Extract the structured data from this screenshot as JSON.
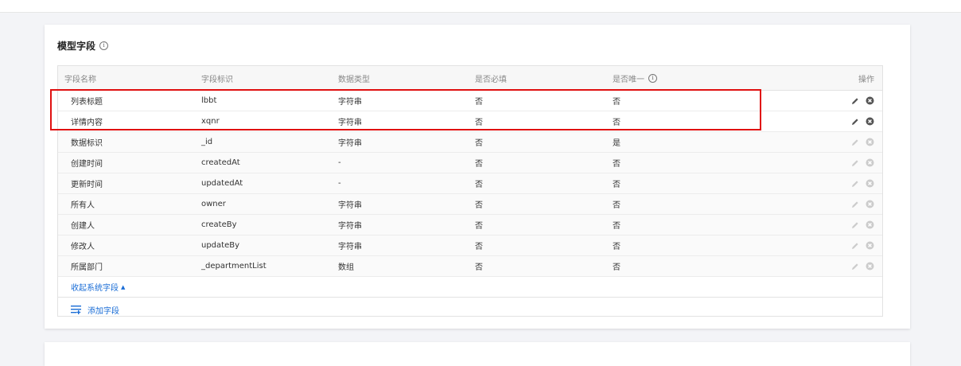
{
  "section": {
    "title": "模型字段"
  },
  "table": {
    "headers": {
      "name": "字段名称",
      "id": "字段标识",
      "type": "数据类型",
      "required": "是否必填",
      "unique": "是否唯一",
      "ops": "操作"
    },
    "rows": [
      {
        "name": "列表标题",
        "id": "lbbt",
        "type": "字符串",
        "required": "否",
        "unique": "否",
        "system": false
      },
      {
        "name": "详情内容",
        "id": "xqnr",
        "type": "字符串",
        "required": "否",
        "unique": "否",
        "system": false
      },
      {
        "name": "数据标识",
        "id": "_id",
        "type": "字符串",
        "required": "否",
        "unique": "是",
        "system": true
      },
      {
        "name": "创建时间",
        "id": "createdAt",
        "type": "-",
        "required": "否",
        "unique": "否",
        "system": true
      },
      {
        "name": "更新时间",
        "id": "updatedAt",
        "type": "-",
        "required": "否",
        "unique": "否",
        "system": true
      },
      {
        "name": "所有人",
        "id": "owner",
        "type": "字符串",
        "required": "否",
        "unique": "否",
        "system": true
      },
      {
        "name": "创建人",
        "id": "createBy",
        "type": "字符串",
        "required": "否",
        "unique": "否",
        "system": true
      },
      {
        "name": "修改人",
        "id": "updateBy",
        "type": "字符串",
        "required": "否",
        "unique": "否",
        "system": true
      },
      {
        "name": "所属部门",
        "id": "_departmentList",
        "type": "数组",
        "required": "否",
        "unique": "否",
        "system": true
      }
    ]
  },
  "collapse_label": "收起系统字段",
  "add_label": "添加字段",
  "colors": {
    "link": "#1a6dd6",
    "highlight": "#e01010",
    "icon_active": "#555555",
    "icon_disabled": "#cccccc"
  }
}
